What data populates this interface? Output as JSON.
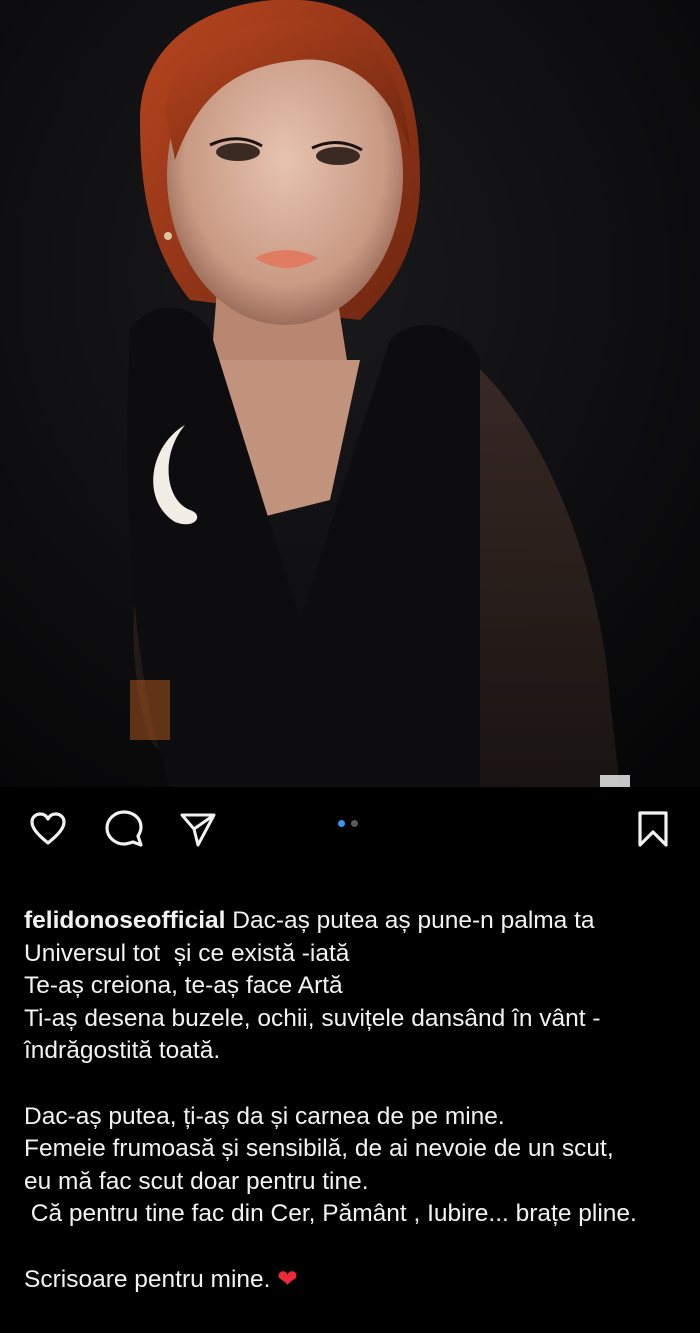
{
  "post": {
    "image_alt": "Portrait of a woman with red hair wearing a black dress with a white crescent-moon detail",
    "carousel": {
      "count": 2,
      "active_index": 0
    }
  },
  "actions": {
    "like_icon": "heart-outline-icon",
    "comment_icon": "comment-bubble-icon",
    "share_icon": "paper-plane-icon",
    "save_icon": "bookmark-outline-icon"
  },
  "caption": {
    "username": "felidonoseofficial",
    "first_line_text": " Dac-aș putea aș pune-n palma ta",
    "lines": [
      "Universul tot  și ce există -iată",
      "Te-aș creiona, te-aș face Artă",
      "Ti-aș desena buzele, ochii, suvițele dansând în vânt -",
      "îndrăgostită toată.",
      "",
      "Dac-aș putea, ți-aș da și carnea de pe mine.",
      "Femeie frumoasă și sensibilă, de ai nevoie de un scut,",
      "eu mă fac scut doar pentru tine.",
      " Că pentru tine fac din Cer, Pământ , Iubire... brațe pline.",
      "",
      "Scrisoare pentru mine. "
    ],
    "heart_emoji": "❤"
  },
  "colors": {
    "background": "#000000",
    "text": "#f2f2f2",
    "carousel_active": "#3897f0",
    "heart": "#ed2a3a"
  }
}
